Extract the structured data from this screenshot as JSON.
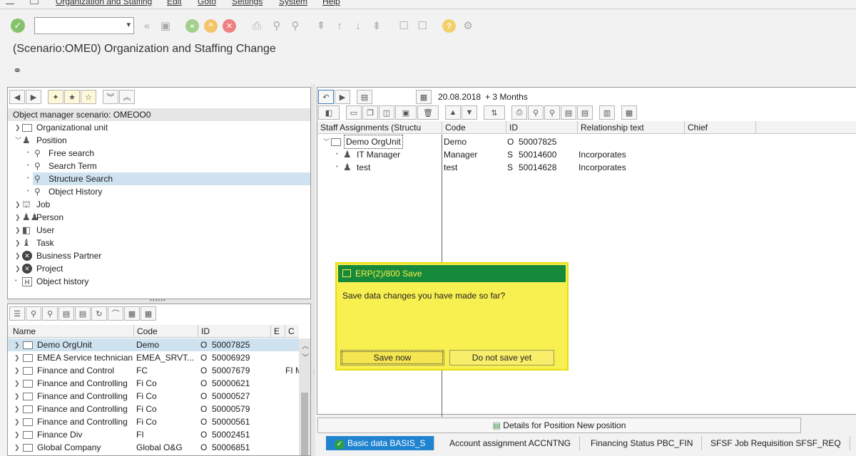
{
  "menu": {
    "items": [
      "Organization and Staffing",
      "Edit",
      "Goto",
      "Settings",
      "System",
      "Help"
    ]
  },
  "title": "(Scenario:OME0) Organization and Staffing Change",
  "left_panel": {
    "header": "Object manager scenario: OMEOO0",
    "tree": [
      {
        "label": "Organizational unit",
        "icon": "org-unit-icon",
        "level": 0,
        "twisty": "collapsed"
      },
      {
        "label": "Position",
        "icon": "person-icon",
        "level": 0,
        "twisty": "expanded"
      },
      {
        "label": "Free search",
        "icon": "binoculars-icon",
        "level": 1
      },
      {
        "label": "Search Term",
        "icon": "binoculars-icon",
        "level": 1
      },
      {
        "label": "Structure Search",
        "icon": "binoculars-icon",
        "level": 1,
        "selected": true
      },
      {
        "label": "Object History",
        "icon": "binoculars-icon",
        "level": 1
      },
      {
        "label": "Job",
        "icon": "job-icon",
        "level": 0,
        "twisty": "collapsed"
      },
      {
        "label": "Person",
        "icon": "persons-icon",
        "level": 0,
        "twisty": "collapsed"
      },
      {
        "label": "User",
        "icon": "user-icon",
        "level": 0,
        "twisty": "collapsed"
      },
      {
        "label": "Task",
        "icon": "task-icon",
        "level": 0,
        "twisty": "collapsed"
      },
      {
        "label": "Business Partner",
        "icon": "x-circle-icon",
        "level": 0,
        "twisty": "collapsed"
      },
      {
        "label": "Project",
        "icon": "x-circle-icon",
        "level": 0,
        "twisty": "collapsed"
      },
      {
        "label": "Object history",
        "icon": "history-icon",
        "level": 0,
        "twisty": "none"
      }
    ]
  },
  "hit_list": {
    "columns": [
      "Name",
      "Code",
      "ID",
      "E",
      "C"
    ],
    "rows": [
      {
        "name": "Demo OrgUnit",
        "code": "Demo",
        "type": "O",
        "id": "50007825",
        "e": "",
        "c": "",
        "selected": true
      },
      {
        "name": "EMEA Service technician",
        "code": "EMEA_SRVT...",
        "type": "O",
        "id": "50006929",
        "e": "",
        "c": ""
      },
      {
        "name": "Finance and Control",
        "code": "FC",
        "type": "O",
        "id": "50007679",
        "e": "",
        "c": "FI M"
      },
      {
        "name": "Finance and Controlling",
        "code": "Fi Co",
        "type": "O",
        "id": "50000621",
        "e": "",
        "c": ""
      },
      {
        "name": "Finance and Controlling",
        "code": "Fi Co",
        "type": "O",
        "id": "50000527",
        "e": "",
        "c": ""
      },
      {
        "name": "Finance and Controlling",
        "code": "Fi Co",
        "type": "O",
        "id": "50000579",
        "e": "",
        "c": ""
      },
      {
        "name": "Finance and Controlling",
        "code": "Fi Co",
        "type": "O",
        "id": "50000561",
        "e": "",
        "c": ""
      },
      {
        "name": "Finance Div",
        "code": "FI",
        "type": "O",
        "id": "50002451",
        "e": "",
        "c": ""
      },
      {
        "name": "Global Company",
        "code": "Global O&G",
        "type": "O",
        "id": "50006851",
        "e": "",
        "c": ""
      }
    ]
  },
  "right_panel": {
    "date": "20.08.2018",
    "period": "+ 3 Months",
    "columns": [
      "Staff Assignments (Structu",
      "Code",
      "ID",
      "Relationship text",
      "Chief"
    ],
    "rows": [
      {
        "name": "Demo OrgUnit",
        "code": "Demo",
        "type": "O",
        "id": "50007825",
        "rel": "",
        "chief": ""
      },
      {
        "name": "IT Manager",
        "code": "Manager",
        "type": "S",
        "id": "50014600",
        "rel": "Incorporates",
        "chief": ""
      },
      {
        "name": "test",
        "code": "test",
        "type": "S",
        "id": "50014628",
        "rel": "Incorporates",
        "chief": ""
      }
    ]
  },
  "dialog": {
    "title": "ERP(2)/800 Save",
    "message": "Save data changes you have made so far?",
    "save_label": "Save now",
    "nosave_label": "Do not save yet"
  },
  "details": {
    "label": "Details for Position New position"
  },
  "tabs": [
    {
      "label": "Basic data BASIS_S",
      "active": true
    },
    {
      "label": "Account assignment ACCNTNG"
    },
    {
      "label": "Financing Status PBC_FIN"
    },
    {
      "label": "SFSF Job Requisition SFSF_REQ"
    }
  ],
  "colors": {
    "dialog_bg": "#f8f050",
    "dialog_title_bg": "#17893a",
    "tab_active": "#1f83d0",
    "selection": "#cfe2f0"
  }
}
